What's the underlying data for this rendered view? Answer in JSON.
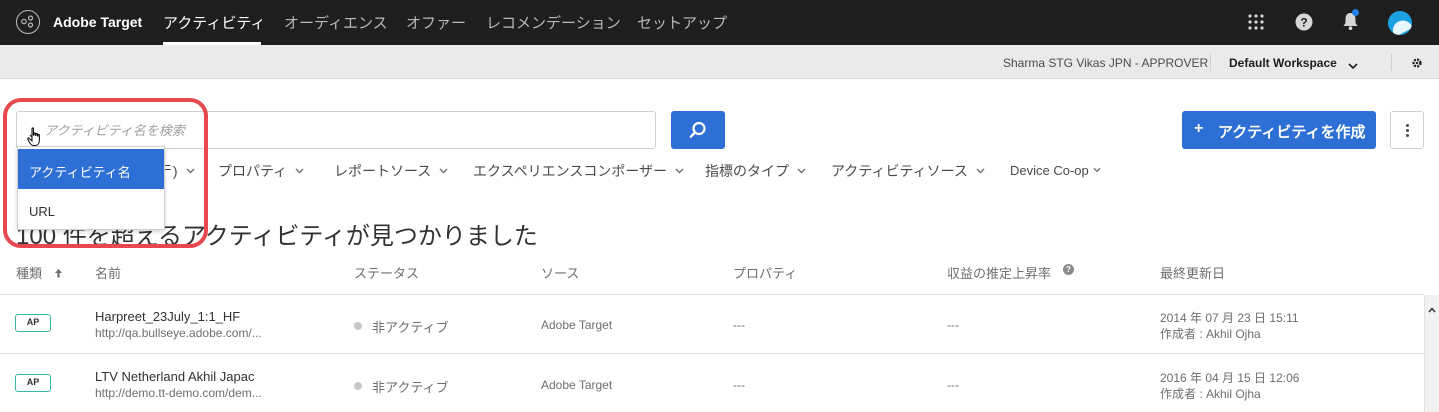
{
  "app": {
    "name": "Adobe Target"
  },
  "nav": {
    "items": [
      {
        "label": "アクティビティ",
        "active": true
      },
      {
        "label": "オーディエンス",
        "active": false
      },
      {
        "label": "オファー",
        "active": false
      },
      {
        "label": "レコメンデーション",
        "active": false
      },
      {
        "label": "セットアップ",
        "active": false
      }
    ],
    "icons": [
      "apps-grid-icon",
      "help-icon",
      "bell-icon",
      "avatar"
    ]
  },
  "subbar": {
    "user": "Sharma STG Vikas JPN - APPROVER",
    "workspace": "Default Workspace"
  },
  "search": {
    "placeholder": "アクティビティ名を検索",
    "value": "",
    "dropdown": {
      "options": [
        "アクティビティ名",
        "URL"
      ],
      "selected": "アクティビティ名"
    }
  },
  "toolbar": {
    "create_plus": "+",
    "create_label": "アクティビティを作成"
  },
  "filters": [
    {
      "label": "ᄃ)"
    },
    {
      "label": "プロパティ"
    },
    {
      "label": "レポートソース"
    },
    {
      "label": "エクスペリエンスコンポーザー"
    },
    {
      "label": "指標のタイプ"
    },
    {
      "label": "アクティビティソース"
    },
    {
      "label": "Device Co-op"
    }
  ],
  "results": {
    "title": "100 件を超えるアクティビティが見つかりました",
    "columns": {
      "type": "種類",
      "name": "名前",
      "status": "ステータス",
      "source": "ソース",
      "property": "プロパティ",
      "lift": "収益の推定上昇率",
      "updated": "最終更新日"
    },
    "rows": [
      {
        "type": "AP",
        "name": "Harpreet_23July_1:1_HF",
        "url": "http://qa.bullseye.adobe.com/...",
        "status": "非アクティブ",
        "source": "Adobe Target",
        "property": "---",
        "lift": "---",
        "updated": "2014 年 07 月 23 日 15:11",
        "author": "作成者 : Akhil Ojha"
      },
      {
        "type": "AP",
        "name": "LTV Netherland Akhil Japac",
        "url": "http://demo.tt-demo.com/dem...",
        "status": "非アクティブ",
        "source": "Adobe Target",
        "property": "---",
        "lift": "---",
        "updated": "2016 年 04 月 15 日 12:06",
        "author": "作成者 : Akhil Ojha"
      }
    ]
  },
  "colors": {
    "topnav": "#1e1e1e",
    "accent": "#2d6fd4",
    "highlight": "#e5484d",
    "badge_border": "#3fb69f"
  }
}
